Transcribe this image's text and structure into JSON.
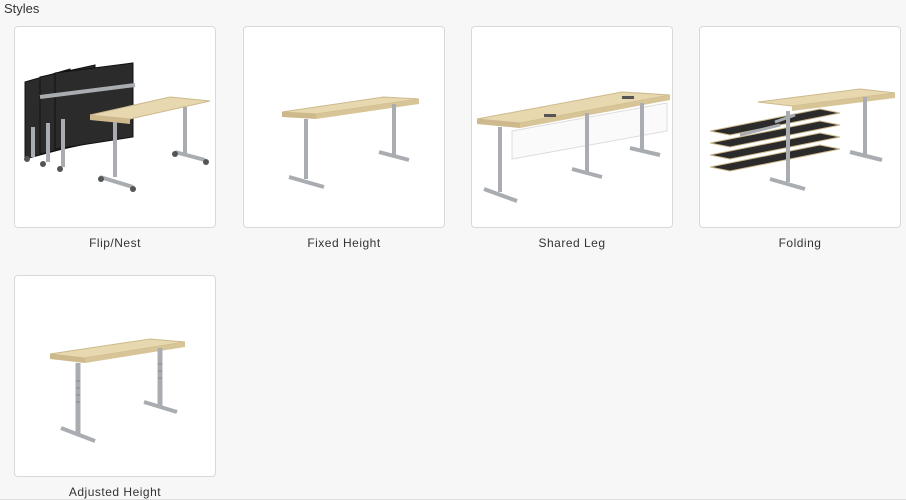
{
  "section": {
    "title": "Styles"
  },
  "styles": [
    {
      "label": "Flip/Nest",
      "icon": "flip-nest-table-image"
    },
    {
      "label": "Fixed Height",
      "icon": "fixed-height-table-image"
    },
    {
      "label": "Shared Leg",
      "icon": "shared-leg-table-image"
    },
    {
      "label": "Folding",
      "icon": "folding-table-image"
    },
    {
      "label": "Adjusted Height",
      "icon": "adjusted-height-table-image"
    }
  ],
  "colors": {
    "tabletop": "#e8d8b0",
    "tabletop_edge": "#cdb98c",
    "leg": "#a9adb1",
    "dark_panel": "#2b2b2b"
  }
}
